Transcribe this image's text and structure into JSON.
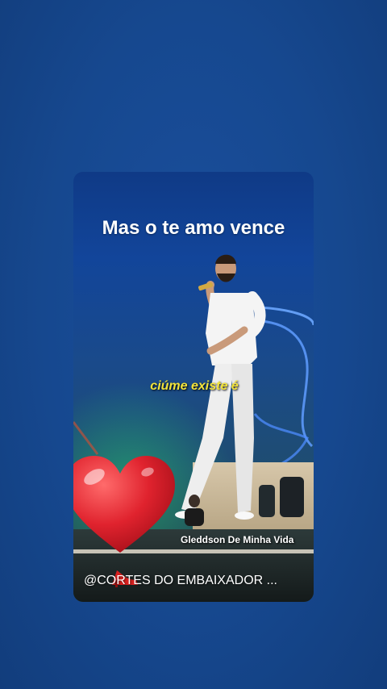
{
  "story": {
    "caption": "Mas o te amo vence",
    "subtitle": "ciúme existe é",
    "credit": "Gleddson De Minha Vida",
    "handle": "@CORTES DO EMBAIXADOR ..."
  },
  "icons": {
    "heart": "red-heart-emoji",
    "shoe": "high-heel-emoji"
  },
  "colors": {
    "background": "#16488f",
    "subtitle": "#f2e33a",
    "heart": "#e0232e"
  }
}
